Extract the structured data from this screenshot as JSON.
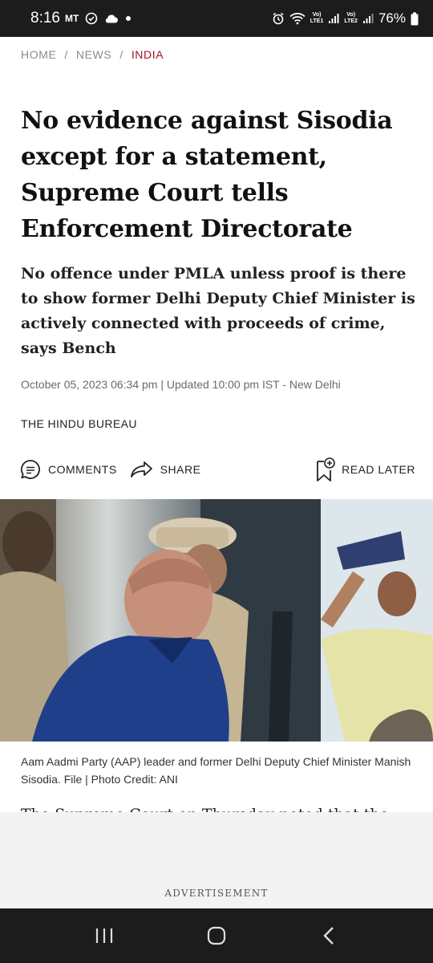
{
  "status_bar": {
    "time": "8:16",
    "carrier": "MT",
    "battery": "76%",
    "sim1_top": "Vo)",
    "sim1_bottom": "LTE1",
    "sim2_top": "Vo)",
    "sim2_bottom": "LTE2"
  },
  "breadcrumb": {
    "home": "HOME",
    "news": "NEWS",
    "section": "INDIA",
    "separator": "/"
  },
  "article": {
    "headline": "No evidence against Sisodia except for a statement, Supreme Court tells Enforcement Directorate",
    "subhead": "No offence under PMLA unless proof is there to show former Delhi Deputy Chief Minister is actively connected with proceeds of crime, says Bench",
    "dateline": "October 05, 2023 06:34 pm | Updated 10:00 pm IST - New Delhi",
    "byline": "THE HINDU BUREAU",
    "caption": "Aam Aadmi Party (AAP) leader and former Delhi Deputy Chief Minister Manish Sisodia. File | Photo Credit: ANI",
    "body_peek": "The Supreme Court on Thursday noted that the"
  },
  "actions": {
    "comments": "COMMENTS",
    "share": "SHARE",
    "read_later": "READ LATER"
  },
  "ad": {
    "label": "ADVERTISEMENT"
  },
  "icons": {
    "comments": "comment-bubble-icon",
    "share": "share-arrow-icon",
    "read_later": "bookmark-plus-icon",
    "recents": "recents-icon",
    "home": "home-icon",
    "back": "back-icon"
  },
  "colors": {
    "accent": "#a3122a",
    "status_bar": "#1c1c1c",
    "nav_bar": "#1c1c1c"
  }
}
